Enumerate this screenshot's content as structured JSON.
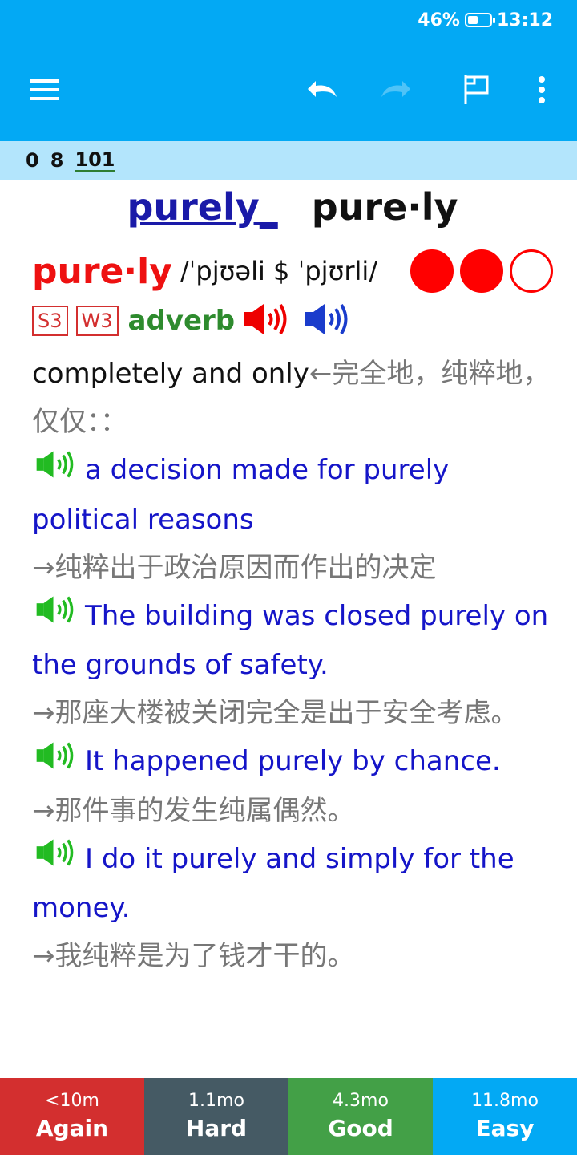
{
  "status": {
    "battery_text": "46%",
    "battery_level": 0.46,
    "time": "13:12"
  },
  "toolbar": {
    "icons": [
      "menu-icon",
      "undo-icon",
      "redo-icon",
      "flag-icon",
      "more-vert-icon"
    ],
    "colors": {
      "bar": "#03a9f4",
      "counts_bar": "#b3e5fc"
    }
  },
  "counts": {
    "new": "0",
    "learn": "8",
    "due": "101"
  },
  "card": {
    "headword_link": "purely_",
    "headword_plain": "pure·ly",
    "entry_word": "pure·ly",
    "pronunciation": "/ˈpjʊəli $ ˈpjʊrli/",
    "frequency": {
      "filled": 2,
      "total": 3
    },
    "tags": [
      "S3",
      "W3"
    ],
    "pos": "adverb",
    "definition_en": "completely and only",
    "definition_cn": "←完全地，纯粹地，仅仅：：",
    "examples": [
      {
        "en": "a decision made for purely political reasons",
        "cn": "→纯粹出于政治原因而作出的决定"
      },
      {
        "en": "The building was closed purely on the grounds of safety.",
        "cn": "→那座大楼被关闭完全是出于安全考虑。"
      },
      {
        "en": "It happened purely by chance.",
        "cn": "→那件事的发生纯属偶然。"
      },
      {
        "en": "I do it purely and simply for the money.",
        "cn": "→我纯粹是为了钱才干的。"
      }
    ]
  },
  "answers": [
    {
      "interval": "<10m",
      "label": "Again",
      "color": "#d32f2f"
    },
    {
      "interval": "1.1mo",
      "label": "Hard",
      "color": "#455a64"
    },
    {
      "interval": "4.3mo",
      "label": "Good",
      "color": "#43a047"
    },
    {
      "interval": "11.8mo",
      "label": "Easy",
      "color": "#03a9f4"
    }
  ]
}
